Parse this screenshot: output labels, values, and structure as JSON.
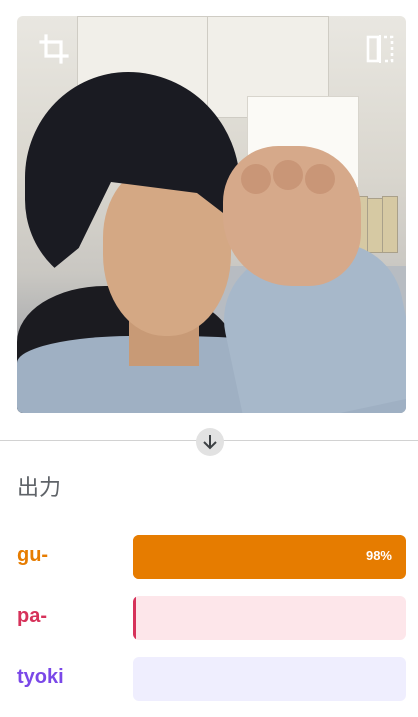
{
  "camera": {
    "crop_icon": "crop-icon",
    "mirror_icon": "flip-icon"
  },
  "output": {
    "title": "出力",
    "arrow_icon": "arrow-down-icon"
  },
  "classes": [
    {
      "label": "gu-",
      "percent_text": "98%",
      "value": 0.98,
      "color": "#e67c00",
      "track": "#e67c00"
    },
    {
      "label": "pa-",
      "percent_text": "",
      "value": 0.01,
      "color": "#d6325a",
      "track": "#fde6ea"
    },
    {
      "label": "tyoki",
      "percent_text": "",
      "value": 0.0,
      "color": "#7a48e8",
      "track": "#efeefe"
    }
  ]
}
